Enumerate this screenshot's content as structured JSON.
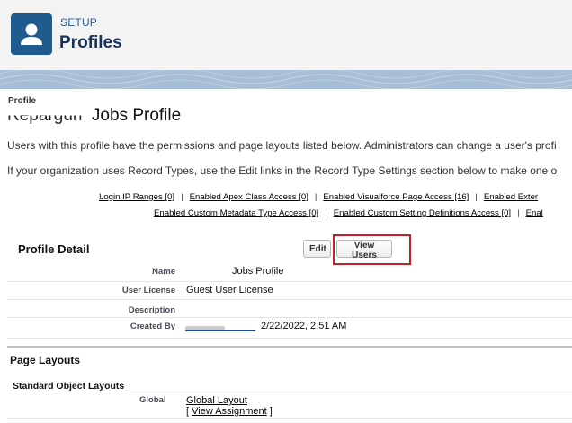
{
  "header": {
    "eyebrow": "SETUP",
    "title": "Profiles",
    "icon": "user-icon",
    "accent_color": "#1f5b8e"
  },
  "breadcrumb": "Profile",
  "page": {
    "title_prefix": "Repargun",
    "title": "Jobs Profile",
    "description_1": "Users with this profile have the permissions and page layouts listed below. Administrators can change a user's profi",
    "description_2": "If your organization uses Record Types, use the Edit links in the Record Type Settings section below to make one o"
  },
  "links_row_1": [
    "Login IP Ranges [0]",
    "Enabled Apex Class Access [0]",
    "Enabled Visualforce Page Access [16]",
    "Enabled Exter"
  ],
  "links_row_2": [
    "Enabled Custom Metadata Type Access [0]",
    "Enabled Custom Setting Definitions Access [0]",
    "Enal"
  ],
  "separator": "|",
  "profile_detail": {
    "section_title": "Profile Detail",
    "edit_label": "Edit",
    "view_users_label": "View Users",
    "highlight_color": "#c0222a",
    "fields": {
      "name_label": "Name",
      "name_value": "Jobs Profile",
      "license_label": "User License",
      "license_value": "Guest User License",
      "description_label": "Description",
      "created_label": "Created By",
      "created_value": "2/22/2022, 2:51 AM"
    }
  },
  "page_layouts": {
    "title": "Page Layouts",
    "subtitle": "Standard Object Layouts",
    "global_label": "Global",
    "global_link": "Global Layout",
    "assign_open": "[ ",
    "assign_link": "View Assignment",
    "assign_close": " ]"
  }
}
